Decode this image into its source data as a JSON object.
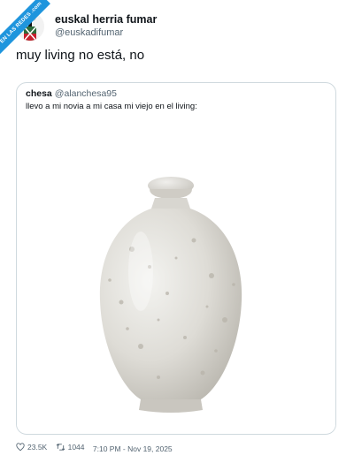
{
  "watermark": {
    "text": "VISTO EN LAS REDES .com"
  },
  "tweet": {
    "display_name": "euskal herria fumar",
    "handle": "@euskadifumar",
    "text": "muy living no está, no",
    "avatar_icon": "avatar-icon"
  },
  "quoted_tweet": {
    "author": "chesa",
    "handle": "@alanchesa95",
    "text": "llevo a mi novia a mi casa mi viejo en el living:",
    "image_icon": "funeral-urn-image"
  },
  "footer": {
    "likes": "23.5K",
    "retweets": "1044",
    "timestamp": "7:10 PM - Nov 19, 2025"
  },
  "colors": {
    "badge": "#1f95dd",
    "muted": "#536471",
    "text": "#0f1419",
    "border": "#cfd9de"
  }
}
